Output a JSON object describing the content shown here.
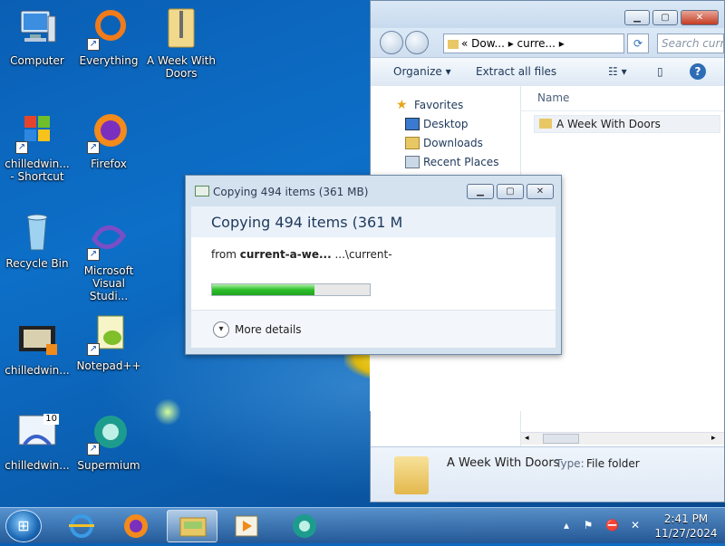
{
  "desktop": {
    "icons": [
      {
        "label": "Computer"
      },
      {
        "label": "Everything"
      },
      {
        "label": "A Week With Doors"
      },
      {
        "label": "chilledwin... - Shortcut"
      },
      {
        "label": "Firefox"
      },
      {
        "label": "Recycle Bin"
      },
      {
        "label": "Microsoft Visual Studi..."
      },
      {
        "label": "chilledwin..."
      },
      {
        "label": "Notepad++"
      },
      {
        "label": "chilledwin..."
      },
      {
        "label": "Supermium"
      }
    ],
    "icon_badge_10": "10"
  },
  "explorer": {
    "address": "« Dow... ▸ curre... ▸",
    "search_placeholder": "Search curr...",
    "toolbar": {
      "organize": "Organize ▾",
      "extract": "Extract all files"
    },
    "nav": {
      "favorites": "Favorites",
      "desktop": "Desktop",
      "downloads": "Downloads",
      "recent": "Recent Places"
    },
    "column_name": "Name",
    "items": [
      {
        "name": "A Week With Doors"
      }
    ],
    "details": {
      "name": "A Week With Doors",
      "type_label": "Type:",
      "type_value": "File folder"
    }
  },
  "copy_dialog": {
    "title": "Copying 494 items (361 MB)",
    "header": "Copying 494 items (361 M",
    "from_label": "from",
    "from_source": "current-a-we...",
    "from_dest": "...\\current-",
    "progress": 0.65,
    "more_details": "More details"
  },
  "taskbar": {
    "time": "2:41 PM",
    "date": "11/27/2024"
  },
  "colors": {
    "accent": "#0a5fb4",
    "progress": "#2ec02a",
    "close": "#c43b22"
  }
}
